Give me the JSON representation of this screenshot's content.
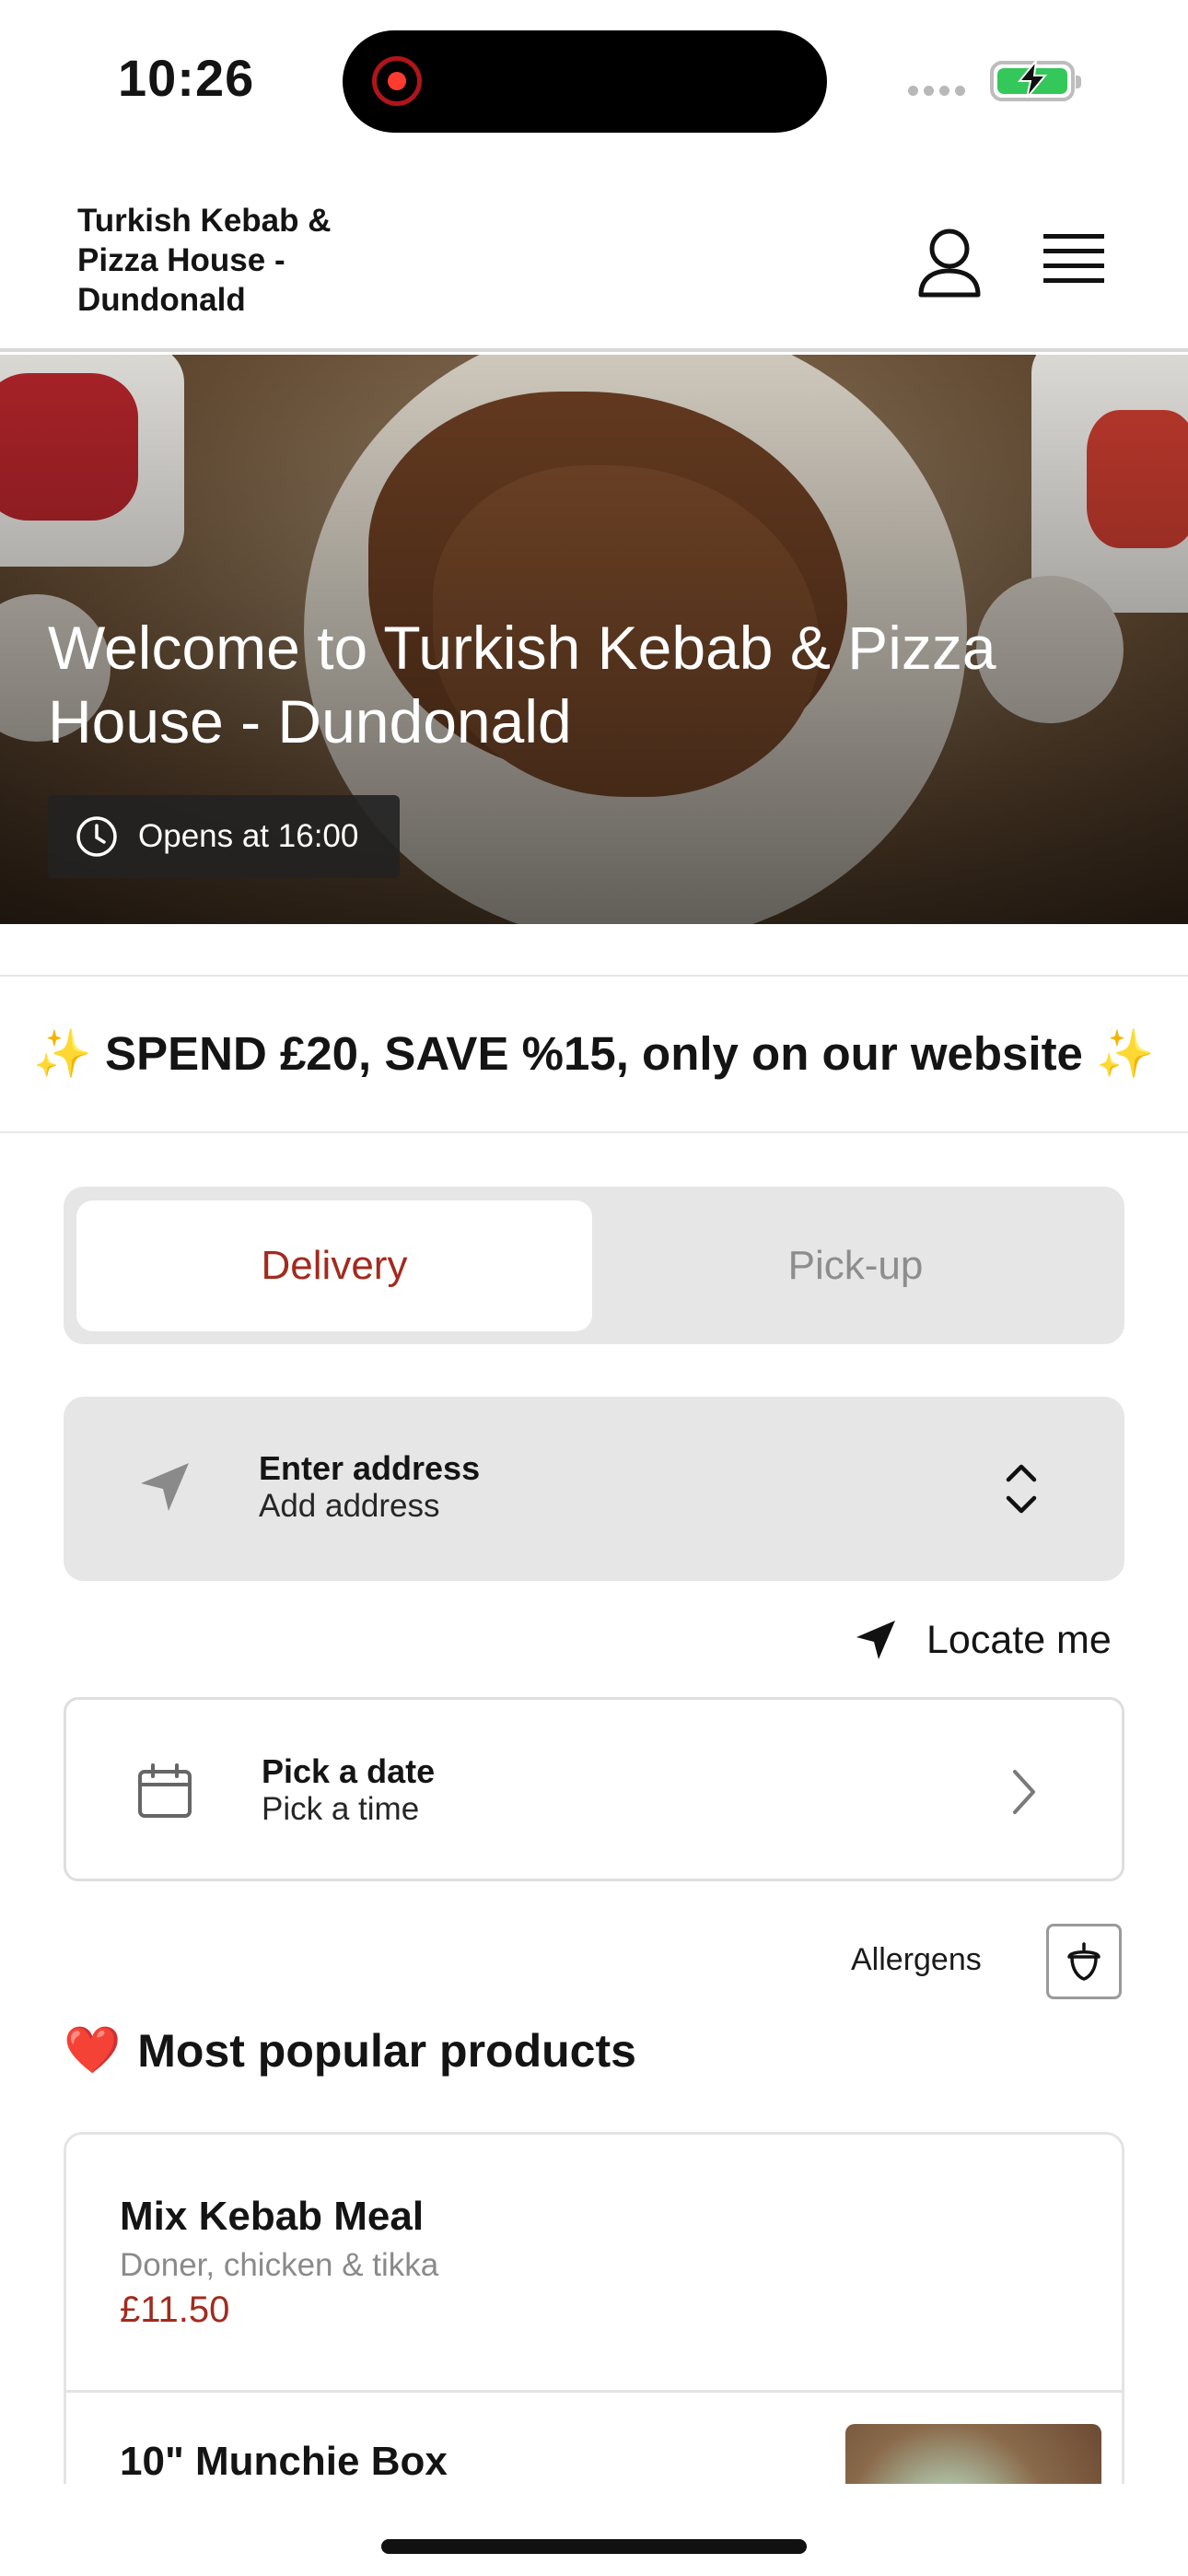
{
  "status_bar": {
    "time": "10:26",
    "battery_state": "charging",
    "colors": {
      "battery": "#34c759",
      "record": "#ff3b30"
    }
  },
  "header": {
    "restaurant_name": "Turkish Kebab & Pizza House - Dundonald",
    "icons": [
      "user-icon",
      "menu-icon"
    ]
  },
  "hero": {
    "title": "Welcome to Turkish Kebab & Pizza House - Dundonald",
    "opening_status": "Opens at 16:00"
  },
  "promo": {
    "text": "✨ SPEND £20, SAVE %15, only on our website ✨"
  },
  "order_mode": {
    "options": [
      "Delivery",
      "Pick-up"
    ],
    "selected": "Delivery",
    "accent": "#a32a1e"
  },
  "address": {
    "title": "Enter address",
    "subtitle": "Add address"
  },
  "locate": {
    "label": "Locate me"
  },
  "schedule": {
    "title": "Pick a date",
    "subtitle": "Pick a time"
  },
  "allergens": {
    "label": "Allergens"
  },
  "popular": {
    "emoji": "❤️",
    "title": "Most popular products",
    "items": [
      {
        "name": "Mix Kebab Meal",
        "description": "Doner, chicken & tikka",
        "price": "£11.50"
      },
      {
        "name": "10\" Munchie Box",
        "description": "",
        "price": ""
      }
    ]
  }
}
